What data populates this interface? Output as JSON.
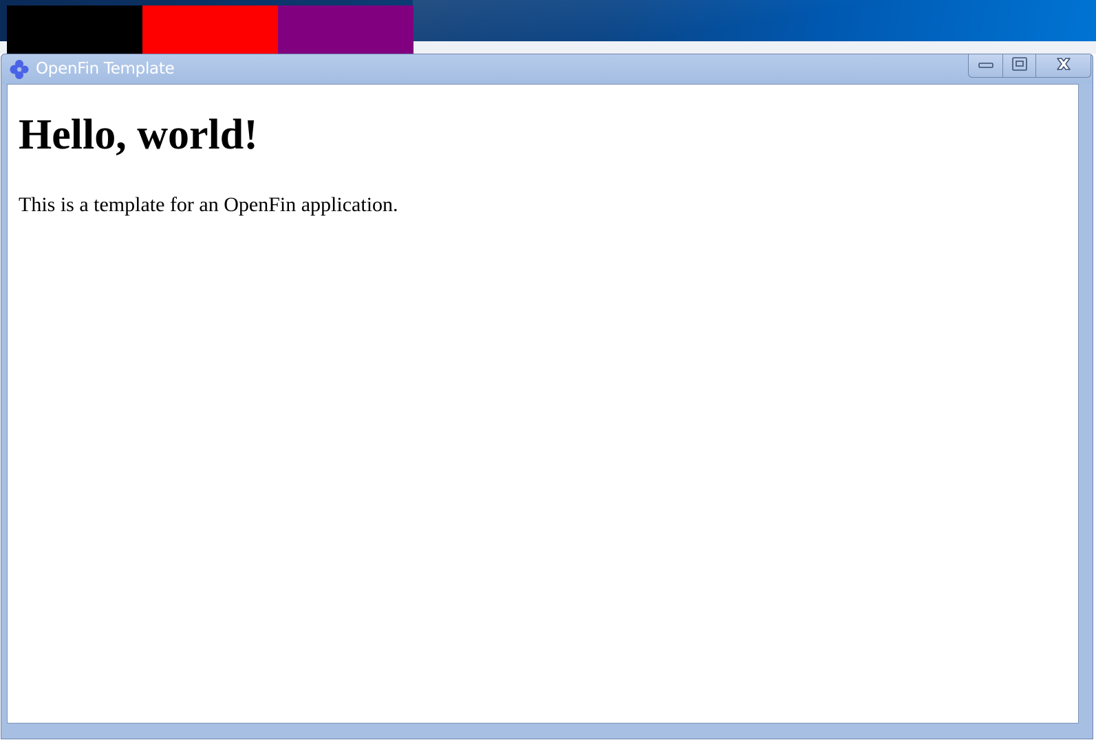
{
  "desktop": {
    "swatches": [
      {
        "name": "black",
        "color": "#000000"
      },
      {
        "name": "red",
        "color": "#ff0000"
      },
      {
        "name": "purple",
        "color": "#800080"
      }
    ]
  },
  "window": {
    "title": "OpenFin Template",
    "icon": "openfin-logo-icon",
    "buttons": {
      "minimize": "minimize-icon",
      "maximize": "maximize-icon",
      "close": "close-icon"
    }
  },
  "content": {
    "heading": "Hello, world!",
    "paragraph": "This is a template for an OpenFin application."
  }
}
